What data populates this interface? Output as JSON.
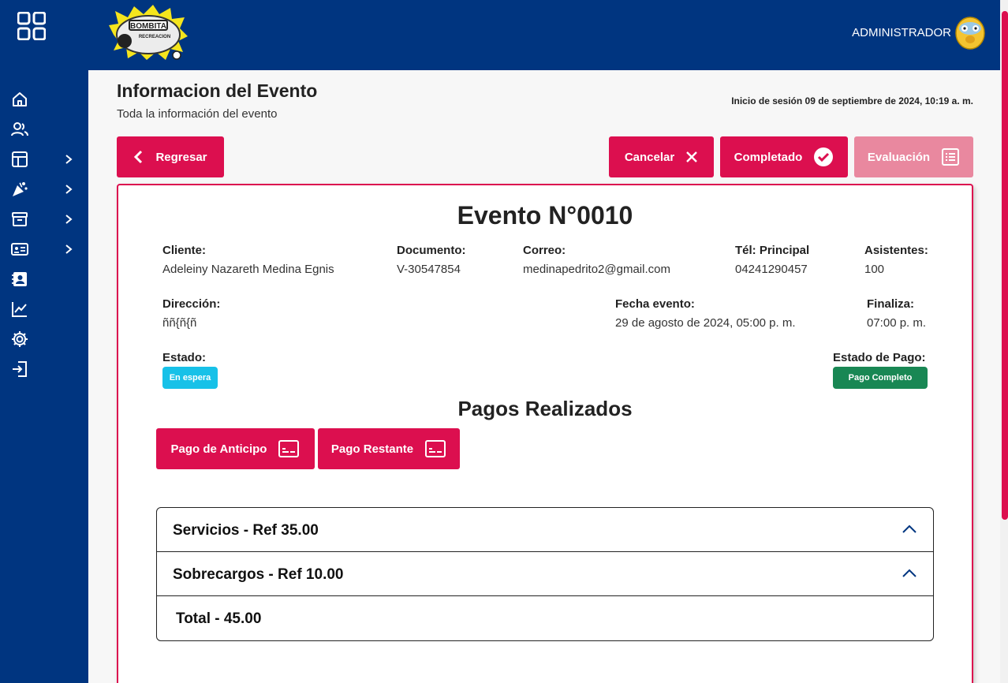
{
  "header": {
    "admin_label": "ADMINISTRADOR"
  },
  "sidebar": {
    "items": [
      {
        "icon": "home-icon"
      },
      {
        "icon": "users-icon"
      },
      {
        "icon": "layout-icon",
        "has_submenu": true
      },
      {
        "icon": "party-icon",
        "has_submenu": true
      },
      {
        "icon": "archive-icon",
        "has_submenu": true
      },
      {
        "icon": "id-card-icon",
        "has_submenu": true
      },
      {
        "icon": "contacts-icon"
      },
      {
        "icon": "chart-icon"
      },
      {
        "icon": "settings-icon"
      },
      {
        "icon": "logout-icon"
      }
    ]
  },
  "page": {
    "title": "Informacion del Evento",
    "subtitle": "Toda la información del evento",
    "session": "Inicio de sesión 09 de septiembre de 2024, 10:19 a. m."
  },
  "actions": {
    "back": "Regresar",
    "cancel": "Cancelar",
    "complete": "Completado",
    "evaluation": "Evaluación"
  },
  "event": {
    "title": "Evento N°0010",
    "client_label": "Cliente:",
    "client": "Adeleiny Nazareth Medina Egnis",
    "document_label": "Documento:",
    "document": "V-30547854",
    "email_label": "Correo:",
    "email": "medinapedrito2@gmail.com",
    "phone_label": "Tél: Principal",
    "phone": "04241290457",
    "attendees_label": "Asistentes:",
    "attendees": "100",
    "address_label": "Dirección:",
    "address": "ññ{ñ{ñ",
    "date_label": "Fecha evento:",
    "date": "29 de agosto de 2024, 05:00 p. m.",
    "end_label": "Finaliza:",
    "end": "07:00 p. m.",
    "status_label": "Estado:",
    "status": "En espera",
    "payment_status_label": "Estado de Pago:",
    "payment_status": "Pago Completo"
  },
  "payments": {
    "title": "Pagos Realizados",
    "advance": "Pago de Anticipo",
    "remaining": "Pago Restante",
    "services": "Servicios - Ref 35.00",
    "surcharges": "Sobrecargos - Ref 10.00",
    "total": "Total - 45.00"
  },
  "colors": {
    "primary": "#003580",
    "accent": "#dc0f4f",
    "accent_disabled": "#e9889f",
    "status_waiting": "#17c1e8",
    "status_paid": "#198754"
  }
}
